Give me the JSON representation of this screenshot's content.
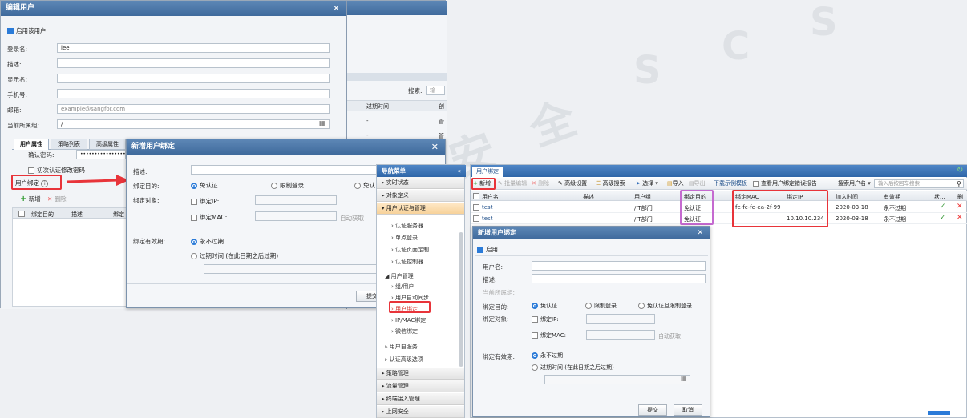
{
  "watermark": [
    "深信服",
    "安",
    "全",
    "S",
    "C",
    "S"
  ],
  "edit_user": {
    "title": "编辑用户",
    "enable_label": "启用该用户",
    "fields": [
      {
        "label": "登录名:",
        "value": "lee"
      },
      {
        "label": "描述:",
        "value": ""
      },
      {
        "label": "显示名:",
        "value": ""
      },
      {
        "label": "手机号:",
        "value": ""
      },
      {
        "label": "邮箱:",
        "value": "example@sangfor.com"
      },
      {
        "label": "当前所属组:",
        "value": "/"
      }
    ],
    "tabs": [
      "用户属性",
      "策略列表",
      "高级属性"
    ],
    "confirm_pwd_label": "确认密码:",
    "confirm_pwd_value": "•••••••••••••••••••",
    "first_change_label": "初次认证修改密码",
    "user_binding_label": "用户绑定",
    "add_label": "新增",
    "delete_label": "删除",
    "table_headers": [
      "绑定目的",
      "描述",
      "绑定"
    ]
  },
  "bg_list": {
    "search_label": "搜索:",
    "search_value": "输",
    "headers": [
      "过期时间",
      "创"
    ],
    "rows": [
      [
        "-",
        "管"
      ],
      [
        "-",
        "管"
      ],
      [
        "-",
        "管"
      ]
    ]
  },
  "new_binding_small": {
    "title": "新增用户绑定",
    "desc_label": "描述:",
    "purpose_label": "绑定目的:",
    "purpose_options": [
      "免认证",
      "限制登录",
      "免认"
    ],
    "target_label": "绑定对象:",
    "ip_label": "绑定IP:",
    "mac_label": "绑定MAC:",
    "auto_get": "自动获取",
    "validity_label": "绑定有效期:",
    "never_expire": "永不过期",
    "expire_time": "过期时间 (在此日期之后过期)",
    "submit": "提交"
  },
  "nav_menu": {
    "title": "导航菜单",
    "items": [
      "实时状态",
      "对象定义",
      "用户认证与管理"
    ],
    "sub_items": [
      "认证服务器",
      "单点登录",
      "认证页面定制",
      "认证控制器"
    ],
    "group_title": "用户管理",
    "group_items": [
      "组/用户",
      "用户自动同步",
      "用户绑定",
      "IP/MAC绑定",
      "微信绑定"
    ],
    "more_items": [
      "用户自服务",
      "认证高级选项"
    ],
    "bottom_items": [
      "策略管理",
      "流量管理",
      "终端接入管理",
      "上网安全"
    ]
  },
  "binding_page": {
    "tab": "用户绑定",
    "toolbar": [
      "新增",
      "批量编辑",
      "删除",
      "高级设置",
      "高级搜索",
      "选择",
      "导入",
      "导出",
      "下载示例模板",
      "查看用户绑定错误报告"
    ],
    "search_label": "搜索用户名",
    "search_placeholder": "输入后按回车搜索",
    "headers": [
      "用户名",
      "描述",
      "用户组",
      "绑定目的",
      "绑定MAC",
      "绑定IP",
      "加入时间",
      "有效期",
      "状...",
      "删"
    ],
    "rows": [
      {
        "name": "test",
        "desc": "",
        "group": "/IT部门",
        "purpose": "免认证",
        "mac": "fe-fc-fe-ea-2f-99",
        "ip": "",
        "time": "2020-03-18",
        "validity": "永不过期"
      },
      {
        "name": "test",
        "desc": "",
        "group": "/IT部门",
        "purpose": "免认证",
        "mac": "",
        "ip": "10.10.10.234",
        "time": "2020-03-18",
        "validity": "永不过期"
      }
    ]
  },
  "new_binding_big": {
    "title": "新增用户绑定",
    "enable_label": "启用",
    "user_label": "用户名:",
    "desc_label": "描述:",
    "group_label": "当前所属组:",
    "purpose_label": "绑定目的:",
    "purpose_options": [
      "免认证",
      "限制登录",
      "免认证且限制登录"
    ],
    "target_label": "绑定对象:",
    "ip_label": "绑定IP:",
    "mac_label": "绑定MAC:",
    "auto_get": "自动获取",
    "validity_label": "绑定有效期:",
    "never_expire": "永不过期",
    "expire_time": "过期时间 (在此日期之后过期)",
    "submit": "提交",
    "cancel": "取消"
  }
}
